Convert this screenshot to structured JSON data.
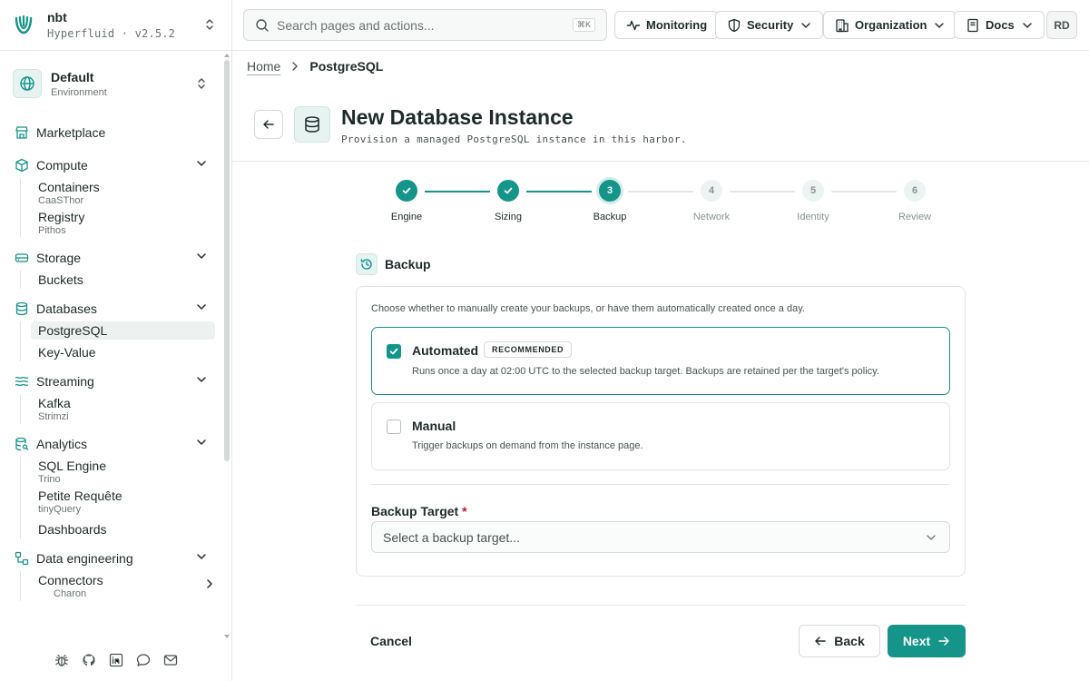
{
  "brand": {
    "name": "nbt",
    "product": "Hyperfluid",
    "version": "v2.5.2",
    "separator": "·"
  },
  "environment": {
    "name": "Default",
    "label": "Environment"
  },
  "sidebar": {
    "marketplace": "Marketplace",
    "compute": {
      "label": "Compute",
      "items": [
        {
          "label": "Containers",
          "sub": "CaaSThor"
        },
        {
          "label": "Registry",
          "sub": "Pithos"
        }
      ]
    },
    "storage": {
      "label": "Storage",
      "items": [
        {
          "label": "Buckets"
        }
      ]
    },
    "databases": {
      "label": "Databases",
      "items": [
        {
          "label": "PostgreSQL"
        },
        {
          "label": "Key-Value"
        }
      ]
    },
    "streaming": {
      "label": "Streaming",
      "items": [
        {
          "label": "Kafka",
          "sub": "Strimzi"
        }
      ]
    },
    "analytics": {
      "label": "Analytics",
      "items": [
        {
          "label": "SQL Engine",
          "sub": "Trino"
        },
        {
          "label": "Petite Requête",
          "sub": "tinyQuery"
        },
        {
          "label": "Dashboards"
        }
      ]
    },
    "data_engineering": {
      "label": "Data engineering",
      "items": [
        {
          "label": "Connectors",
          "sub": "Charon"
        }
      ]
    },
    "footer_icons": [
      "bug-icon",
      "github-icon",
      "linkedin-icon",
      "chat-icon",
      "mail-icon"
    ]
  },
  "topbar": {
    "search_placeholder": "Search pages and actions...",
    "search_shortcut": "⌘K",
    "monitoring": "Monitoring",
    "security": "Security",
    "organization": "Organization",
    "docs": "Docs",
    "user_initials": "RD"
  },
  "breadcrumb": {
    "home": "Home",
    "current": "PostgreSQL"
  },
  "page": {
    "title": "New Database Instance",
    "subtitle": "Provision a managed PostgreSQL instance in this harbor."
  },
  "stepper": {
    "steps": [
      {
        "number": "1",
        "label": "Engine",
        "state": "done"
      },
      {
        "number": "2",
        "label": "Sizing",
        "state": "done"
      },
      {
        "number": "3",
        "label": "Backup",
        "state": "current"
      },
      {
        "number": "4",
        "label": "Network",
        "state": "todo"
      },
      {
        "number": "5",
        "label": "Identity",
        "state": "todo"
      },
      {
        "number": "6",
        "label": "Review",
        "state": "todo"
      }
    ]
  },
  "backup": {
    "section_title": "Backup",
    "description": "Choose whether to manually create your backups, or have them automatically created once a day.",
    "options": [
      {
        "title": "Automated",
        "badge": "RECOMMENDED",
        "description": "Runs once a day at 02:00 UTC to the selected backup target. Backups are retained per the target's policy.",
        "checked": true
      },
      {
        "title": "Manual",
        "description": "Trigger backups on demand from the instance page.",
        "checked": false
      }
    ],
    "target_label": "Backup Target",
    "required_mark": "*",
    "target_placeholder": "Select a backup target..."
  },
  "footer": {
    "cancel": "Cancel",
    "back": "Back",
    "next": "Next"
  },
  "colors": {
    "accent": "#159489",
    "accent_soft": "#e6f3f1",
    "required": "#c8102e"
  }
}
